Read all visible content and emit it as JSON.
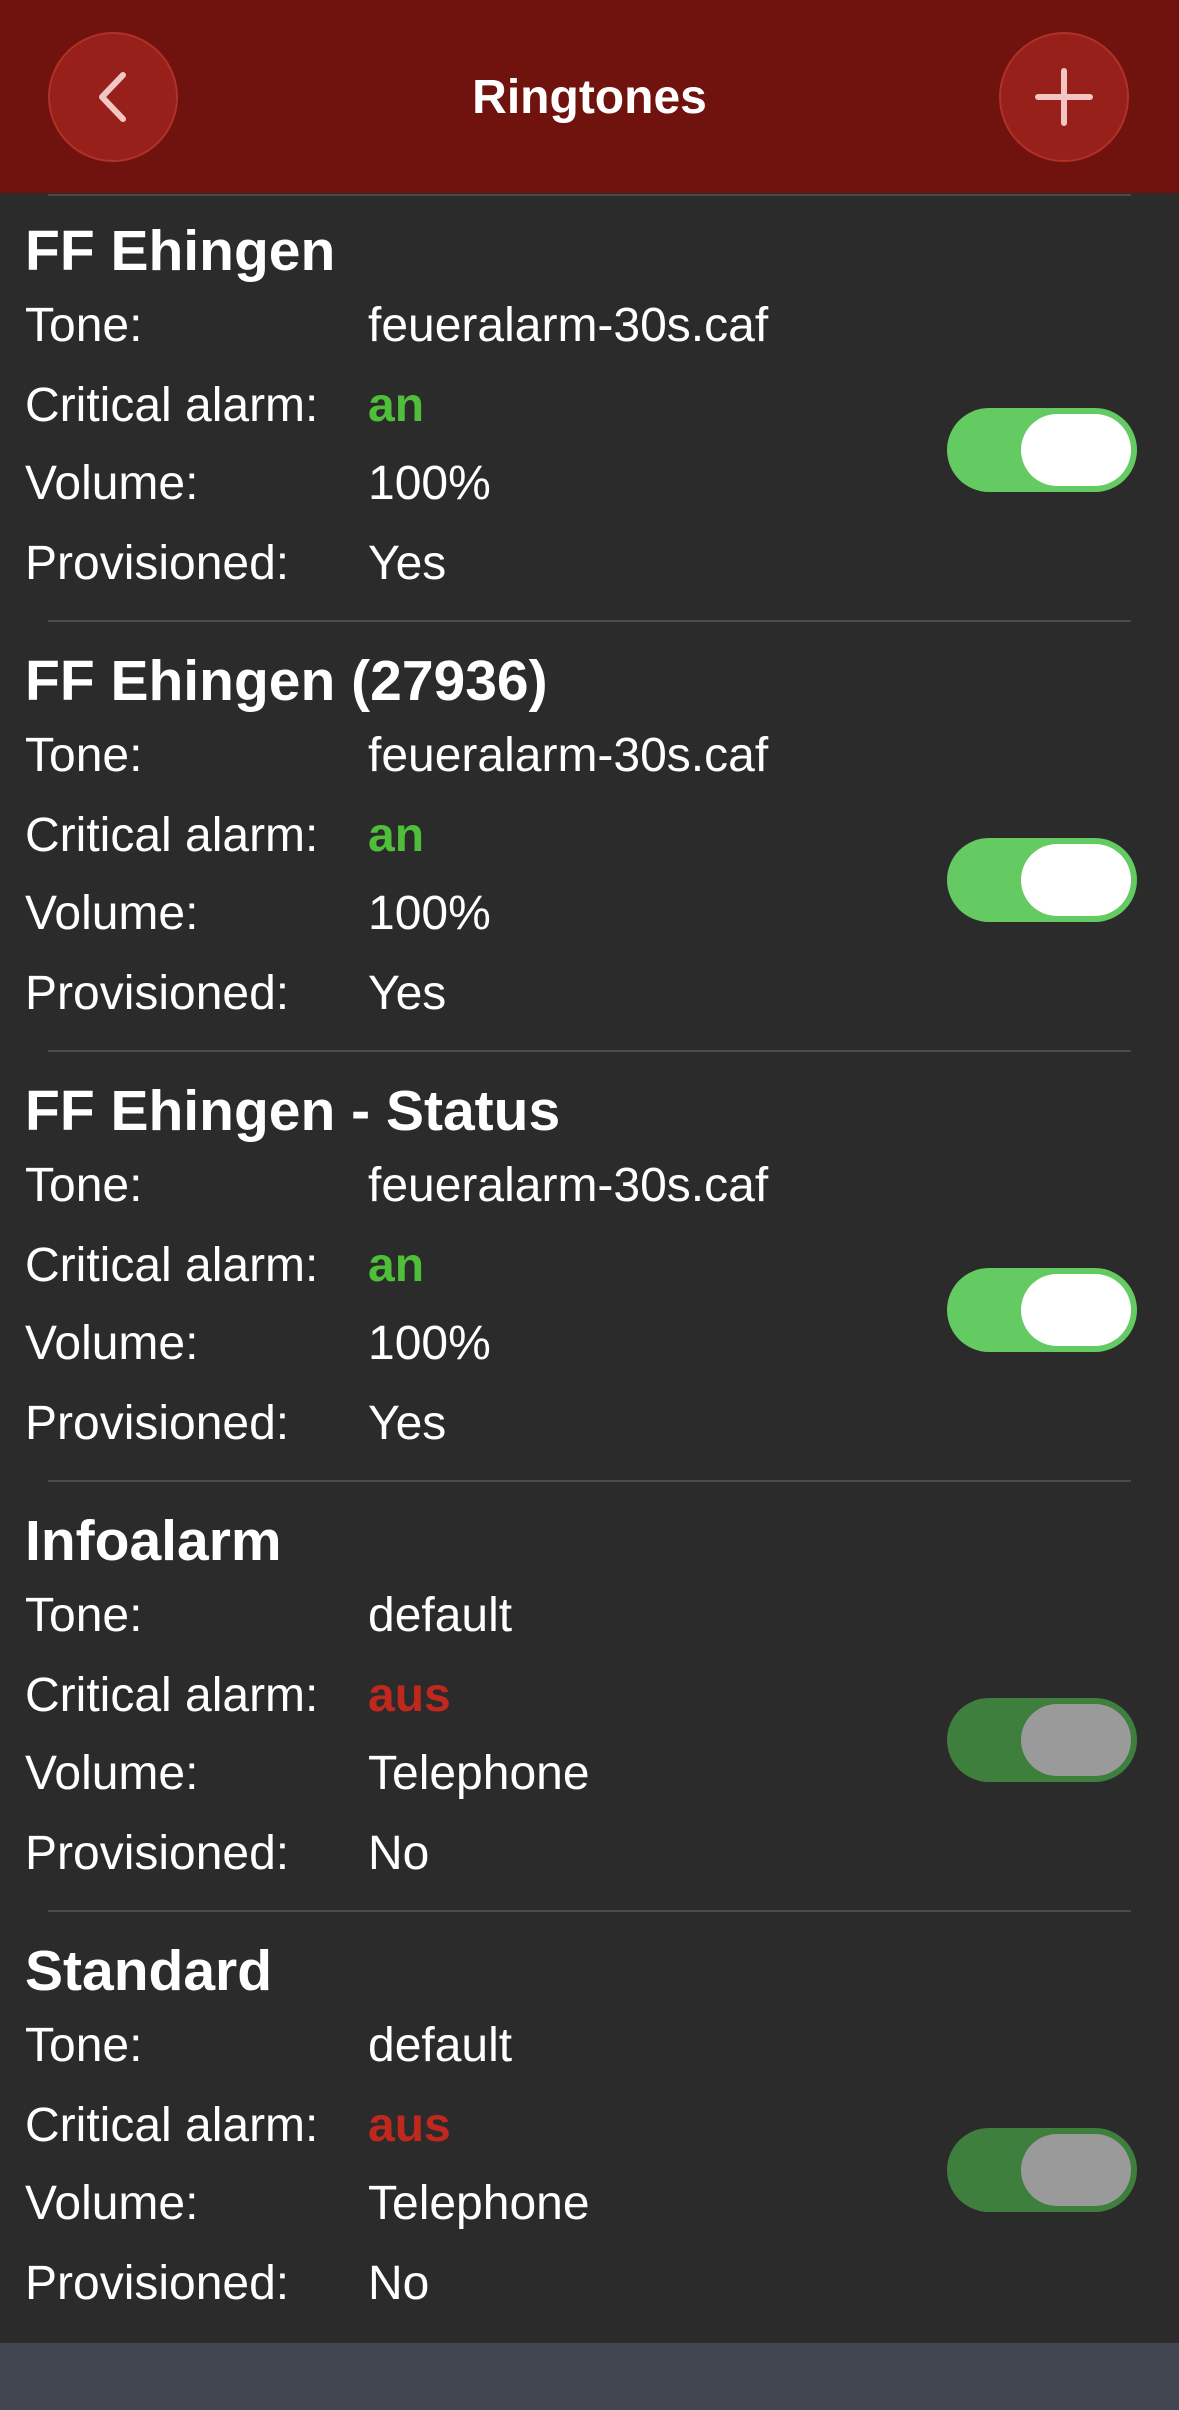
{
  "header": {
    "title": "Ringtones",
    "back_icon": "chevron-left-icon",
    "add_icon": "plus-icon",
    "background": "#70130f"
  },
  "labels": {
    "tone": "Tone:",
    "critical": "Critical alarm:",
    "volume": "Volume:",
    "provisioned": "Provisioned:"
  },
  "colors": {
    "critical_on": "#4fbf3a",
    "critical_off": "#c0281e",
    "toggle_on": "#64cb62",
    "toggle_off": "#3f7f3e"
  },
  "ringtones": [
    {
      "name": "FF Ehingen",
      "tone": "feueralarm-30s.caf",
      "critical": "an",
      "volume": "100%",
      "provisioned": "Yes",
      "enabled": true
    },
    {
      "name": "FF Ehingen (27936)",
      "tone": "feueralarm-30s.caf",
      "critical": "an",
      "volume": "100%",
      "provisioned": "Yes",
      "enabled": true
    },
    {
      "name": "FF Ehingen - Status",
      "tone": "feueralarm-30s.caf",
      "critical": "an",
      "volume": "100%",
      "provisioned": "Yes",
      "enabled": true
    },
    {
      "name": "Infoalarm",
      "tone": "default",
      "critical": "aus",
      "volume": "Telephone",
      "provisioned": "No",
      "enabled": false
    },
    {
      "name": "Standard",
      "tone": "default",
      "critical": "aus",
      "volume": "Telephone",
      "provisioned": "No",
      "enabled": false
    }
  ]
}
